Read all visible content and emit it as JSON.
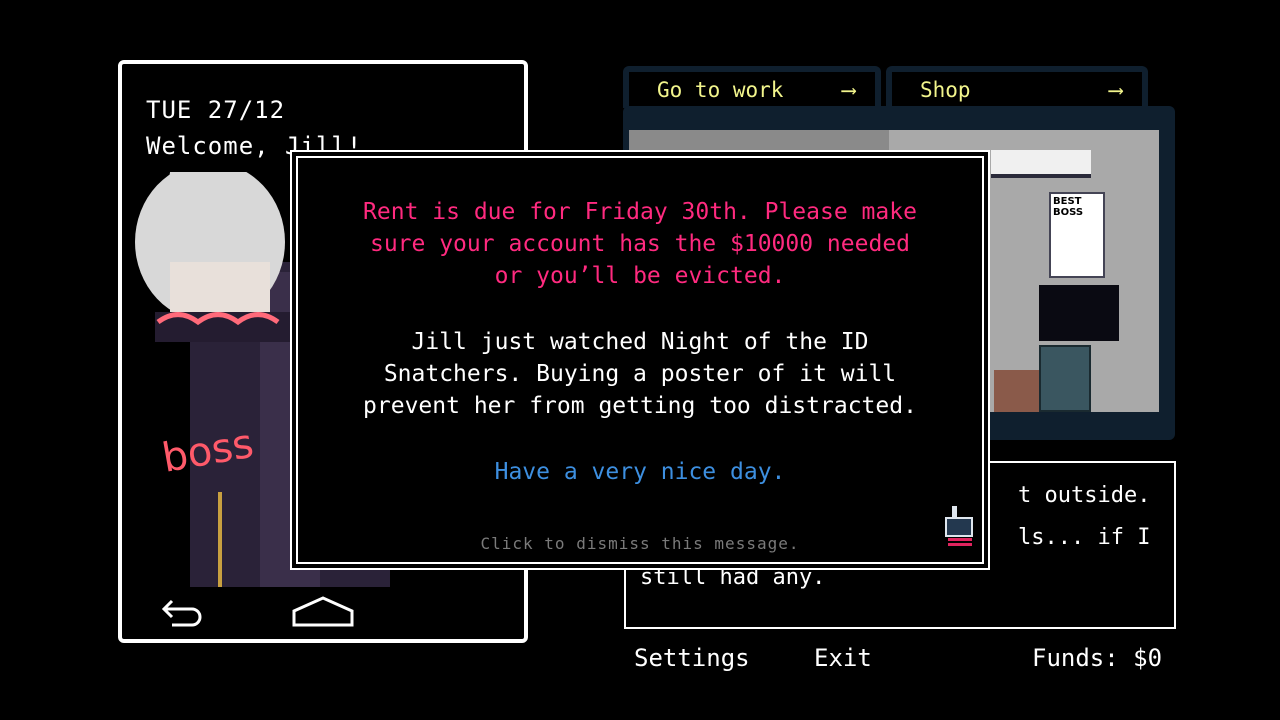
{
  "phone": {
    "date": "TUE 27/12",
    "welcome": "Welcome, Jill!",
    "nav": {
      "back": "back-arrow-icon",
      "home": "home-icon"
    }
  },
  "tabs": [
    {
      "label": "Go to work",
      "icon": "arrow-right-icon"
    },
    {
      "label": "Shop",
      "icon": "arrow-right-icon"
    }
  ],
  "room": {
    "poster": "BEST BOSS"
  },
  "textbox": {
    "lines": [
      "t outside.",
      "ls... if I",
      "still had any."
    ]
  },
  "dialog": {
    "rent": [
      "Rent is due for Friday 30th. Please make",
      "sure your account has the $10000 needed",
      "or you’ll be evicted."
    ],
    "info": [
      "Jill just watched Night of the ID",
      "Snatchers. Buying a poster of it will",
      "prevent her from getting too distracted."
    ],
    "closing": "Have a very nice day.",
    "dismiss": "Click to dismiss this message.",
    "colors": {
      "rent": "#ff2a7f",
      "info": "#ffffff",
      "closing": "#3d8fe0",
      "dismiss": "#7a7a7a"
    }
  },
  "footer": {
    "settings": "Settings",
    "exit": "Exit",
    "funds": "Funds: $0"
  }
}
